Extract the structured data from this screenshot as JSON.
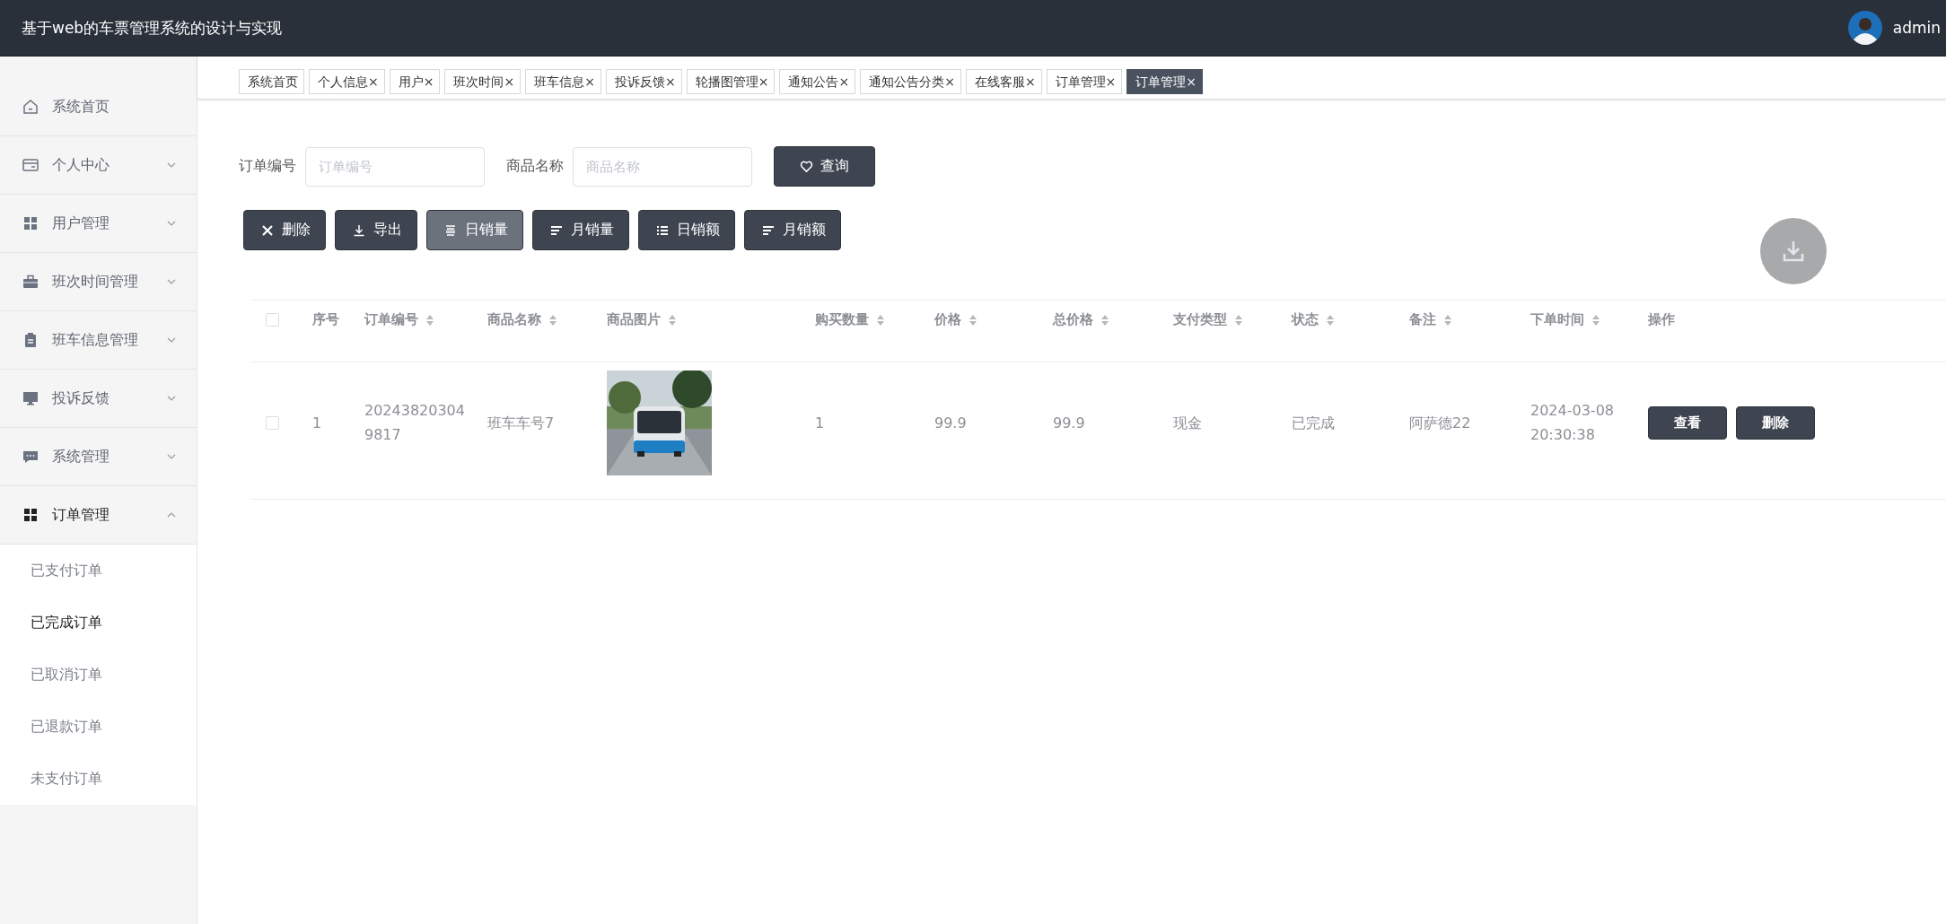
{
  "header": {
    "title": "基于web的车票管理系统的设计与实现",
    "user": "admin"
  },
  "sidebar": {
    "items": [
      {
        "label": "系统首页",
        "kind": "home",
        "selected": false
      },
      {
        "label": "个人中心",
        "kind": "card",
        "expanded": false,
        "selected": false
      },
      {
        "label": "用户管理",
        "kind": "grid",
        "expanded": false,
        "selected": false
      },
      {
        "label": "班次时间管理",
        "kind": "briefcase",
        "expanded": false,
        "selected": false
      },
      {
        "label": "班车信息管理",
        "kind": "clipboard",
        "expanded": false,
        "selected": false
      },
      {
        "label": "投诉反馈",
        "kind": "monitor",
        "expanded": false,
        "selected": false
      },
      {
        "label": "系统管理",
        "kind": "chat",
        "expanded": false,
        "selected": false
      },
      {
        "label": "订单管理",
        "kind": "grid",
        "expanded": true,
        "selected": true,
        "children": [
          {
            "label": "已支付订单",
            "selected": false
          },
          {
            "label": "已完成订单",
            "selected": true
          },
          {
            "label": "已取消订单",
            "selected": false
          },
          {
            "label": "已退款订单",
            "selected": false
          },
          {
            "label": "未支付订单",
            "selected": false
          }
        ]
      }
    ]
  },
  "tabs": [
    {
      "label": "系统首页",
      "selected": false
    },
    {
      "label": "个人信息",
      "close": "×",
      "selected": false
    },
    {
      "label": "用户",
      "close": "×",
      "selected": false
    },
    {
      "label": "班次时间",
      "close": "×",
      "selected": false
    },
    {
      "label": "班车信息",
      "close": "×",
      "selected": false
    },
    {
      "label": "投诉反馈",
      "close": "×",
      "selected": false
    },
    {
      "label": "轮播图管理",
      "close": "×",
      "selected": false
    },
    {
      "label": "通知公告",
      "close": "×",
      "selected": false
    },
    {
      "label": "通知公告分类",
      "close": "×",
      "selected": false
    },
    {
      "label": "在线客服",
      "close": "×",
      "selected": false
    },
    {
      "label": "订单管理",
      "close": "×",
      "selected": false
    },
    {
      "label": "订单管理",
      "close": "×",
      "selected": true
    }
  ],
  "search": {
    "fields": [
      {
        "label": "订单编号",
        "placeholder": "订单编号"
      },
      {
        "label": "商品名称",
        "placeholder": "商品名称"
      }
    ],
    "button": "查询"
  },
  "toolbar": [
    {
      "label": "删除",
      "kind": "close",
      "hovered": false
    },
    {
      "label": "导出",
      "kind": "download",
      "hovered": false
    },
    {
      "label": "日销量",
      "kind": "stack",
      "hovered": true
    },
    {
      "label": "月销量",
      "kind": "sort",
      "hovered": false
    },
    {
      "label": "日销额",
      "kind": "list",
      "hovered": false
    },
    {
      "label": "月销额",
      "kind": "sort",
      "hovered": false
    }
  ],
  "table": {
    "select_all": {
      "checked": false
    },
    "columns": [
      {
        "label": "序号",
        "sortable": false
      },
      {
        "label": "订单编号",
        "sortable": true
      },
      {
        "label": "商品名称",
        "sortable": true
      },
      {
        "label": "商品图片",
        "sortable": true
      },
      {
        "label": "购买数量",
        "sortable": true
      },
      {
        "label": "价格",
        "sortable": true
      },
      {
        "label": "总价格",
        "sortable": true
      },
      {
        "label": "支付类型",
        "sortable": true
      },
      {
        "label": "状态",
        "sortable": true
      },
      {
        "label": "备注",
        "sortable": true
      },
      {
        "label": "下单时间",
        "sortable": true
      },
      {
        "label": "操作",
        "sortable": false
      }
    ],
    "rows": [
      {
        "checked": false,
        "cells": [
          {
            "kind": "text",
            "text": "1"
          },
          {
            "kind": "text",
            "text": "202438203049817"
          },
          {
            "kind": "text",
            "text": "班车车号7"
          },
          {
            "kind": "picture"
          },
          {
            "kind": "text",
            "text": "1"
          },
          {
            "kind": "text",
            "text": "99.9"
          },
          {
            "kind": "text",
            "text": "99.9"
          },
          {
            "kind": "text",
            "text": "现金"
          },
          {
            "kind": "text",
            "text": "已完成"
          },
          {
            "kind": "text",
            "text": "阿萨德22"
          },
          {
            "kind": "text",
            "text": "2024-03-08 20:30:38"
          },
          {
            "kind": "actions",
            "actions": [
              "查看",
              "删除"
            ]
          }
        ]
      }
    ]
  }
}
